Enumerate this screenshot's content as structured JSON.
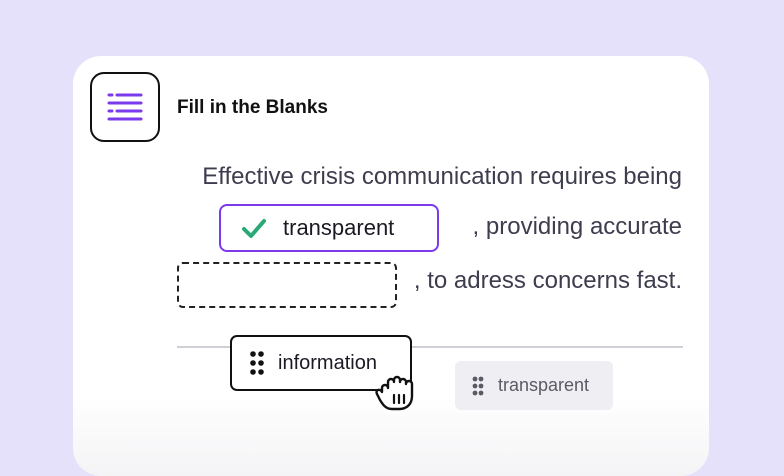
{
  "header": {
    "title": "Fill in the Blanks",
    "icon": "list-lines-icon",
    "accent_color": "#7c3aed"
  },
  "exercise": {
    "line1": "Effective crisis communication requires being",
    "line2_after_blank": ", providing accurate",
    "line3_after_blank": ", to adress concerns fast.",
    "blank1_answer": "transparent",
    "blank1_status": "correct",
    "blank1_status_color": "#2aa876"
  },
  "word_bank": {
    "dragging_word": "information",
    "remaining_word": "transparent"
  }
}
